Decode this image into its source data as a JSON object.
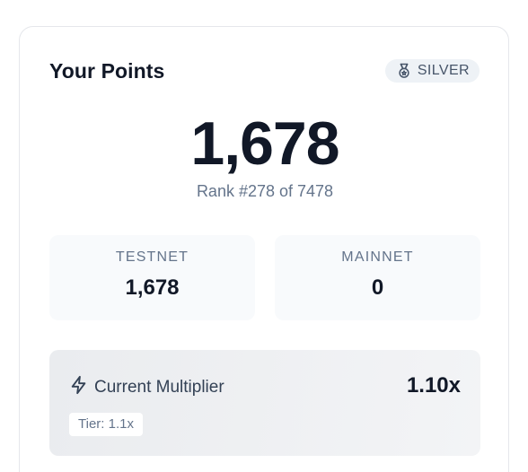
{
  "points_card": {
    "title": "Your Points",
    "tier_badge": {
      "icon": "medal-icon",
      "label": "SILVER"
    },
    "total_points": "1,678",
    "rank_text": "Rank #278 of 7478",
    "stats": [
      {
        "label": "TESTNET",
        "value": "1,678"
      },
      {
        "label": "MAINNET",
        "value": "0"
      }
    ],
    "multiplier": {
      "icon": "lightning-bolt-icon",
      "label": "Current Multiplier",
      "value": "1.10x",
      "tier_chip": "Tier: 1.1x"
    }
  },
  "colors": {
    "title": "#111827",
    "muted_text": "#64748b",
    "badge_bg": "#eef2f6",
    "stat_bg": "#f8fafc",
    "multiplier_bg": "#eaecef",
    "card_border": "#e5e7eb"
  }
}
